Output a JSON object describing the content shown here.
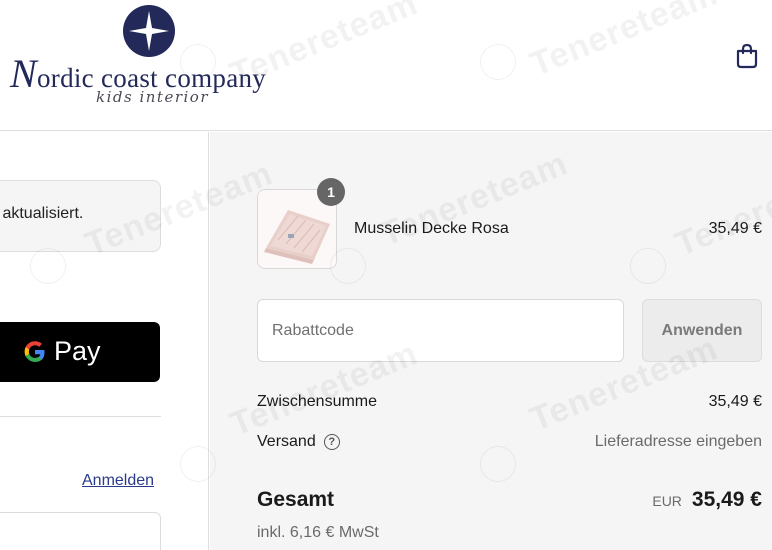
{
  "header": {
    "logo_name_initial": "N",
    "logo_name_rest": "ordic coast company",
    "logo_tagline": "kids interior",
    "cart_icon": "shopping-bag-icon"
  },
  "left": {
    "notice_text": "s aktualisiert.",
    "gpay_label": "Pay",
    "gpay_icon": "google-g-icon",
    "login_link": "Anmelden"
  },
  "summary": {
    "item": {
      "quantity": "1",
      "name": "Musselin Decke Rosa",
      "price": "35,49 €"
    },
    "discount": {
      "placeholder": "Rabattcode",
      "apply_label": "Anwenden"
    },
    "subtotal_label": "Zwischensumme",
    "subtotal_value": "35,49 €",
    "shipping_label": "Versand",
    "shipping_help_icon": "question-circle-icon",
    "shipping_value": "Lieferadresse eingeben",
    "total_label": "Gesamt",
    "total_currency": "EUR",
    "total_value": "35,49 €",
    "tax_note": "inkl. 6,16 € MwSt"
  },
  "watermark": {
    "text": "Tenereteam"
  },
  "colors": {
    "brand_navy": "#232a5a",
    "link_blue": "#2a3a8c",
    "summary_bg": "#f5f5f5"
  }
}
